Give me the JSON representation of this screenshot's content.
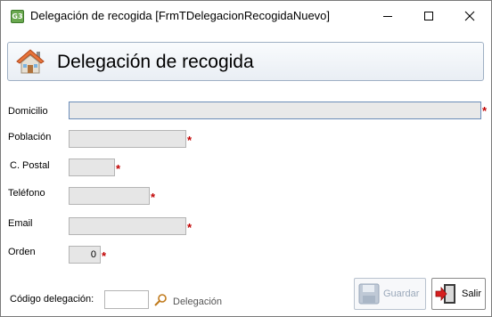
{
  "window": {
    "app_icon_text": "G3",
    "title": "Delegación de recogida [FrmTDelegacionRecogidaNuevo]"
  },
  "header": {
    "title": "Delegación de recogida",
    "icon": "home-icon"
  },
  "form": {
    "domicilio": {
      "label": "Domicilio",
      "value": ""
    },
    "poblacion": {
      "label": "Población",
      "value": ""
    },
    "cpostal": {
      "label": "C. Postal",
      "value": ""
    },
    "telefono": {
      "label": "Teléfono",
      "value": ""
    },
    "email": {
      "label": "Email",
      "value": ""
    },
    "orden": {
      "label": "Orden",
      "value": "0"
    },
    "required_mark": "*"
  },
  "footer": {
    "codigo_label": "Código delegación:",
    "codigo_value": "",
    "delegacion_label": "Delegación",
    "save_label": "Guardar",
    "exit_label": "Salir"
  },
  "colors": {
    "required": "#c00000",
    "header_border": "#9fb0c4",
    "disabled_text": "#9aa8ba"
  }
}
